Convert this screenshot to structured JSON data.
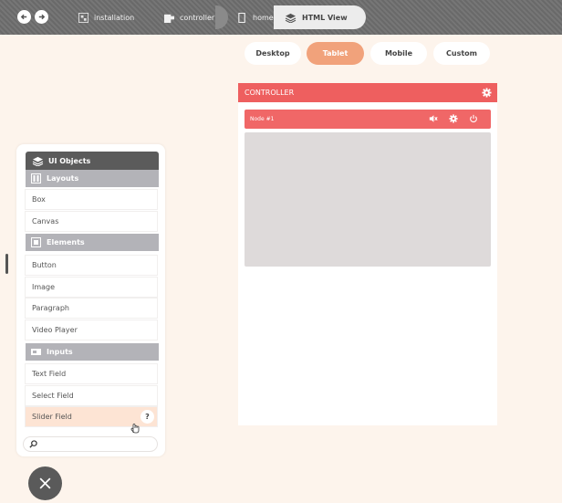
{
  "breadcrumb": {
    "items": [
      {
        "label": "installation",
        "icon": "component-icon"
      },
      {
        "label": "controller",
        "icon": "puzzle-icon"
      },
      {
        "label": "home",
        "icon": "page-icon"
      },
      {
        "label": "HTML View",
        "icon": "layers-icon"
      }
    ]
  },
  "devices": {
    "desktop": "Desktop",
    "tablet": "Tablet",
    "mobile": "Mobile",
    "custom": "Custom",
    "selected": "Tablet"
  },
  "controller": {
    "title": "CONTROLLER",
    "node_label": "Node #1"
  },
  "objects": {
    "title": "UI Objects",
    "sections": {
      "layouts": "Layouts",
      "elements": "Elements",
      "inputs": "Inputs"
    },
    "items": {
      "box": "Box",
      "canvas": "Canvas",
      "button": "Button",
      "image": "Image",
      "paragraph": "Paragraph",
      "video_player": "Video Player",
      "text_field": "Text Field",
      "select_field": "Select Field",
      "slider_field": "Slider Field"
    },
    "help": "?"
  },
  "search": {
    "placeholder": "",
    "value": ""
  },
  "colors": {
    "accent": "#ee5f5f",
    "selected_pill": "#f1a27b",
    "hover_item": "#fde4d4",
    "background": "#fdf4ec"
  }
}
